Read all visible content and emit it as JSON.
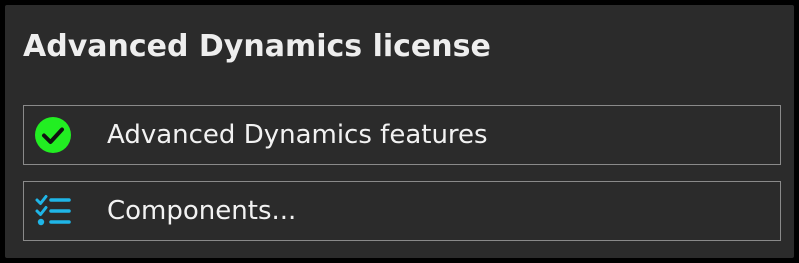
{
  "panel": {
    "title": "Advanced Dynamics license",
    "items": [
      {
        "icon": "check-circle-icon",
        "label": "Advanced Dynamics features",
        "icon_color": "#22ee22"
      },
      {
        "icon": "checklist-icon",
        "label": "Components...",
        "icon_color": "#1fb6e8"
      }
    ]
  },
  "colors": {
    "background": "#2b2b2b",
    "border": "#8a8a8a",
    "text": "#f2f2f2"
  }
}
